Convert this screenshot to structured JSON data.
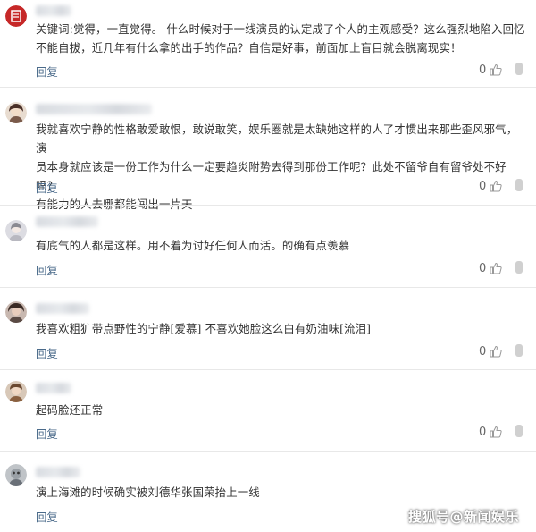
{
  "comments": [
    {
      "text": "关键词:觉得，一直觉得。 什么时候对于一线演员的认定成了个人的主观感受？这么强烈地陷入回忆\n不能自拔，近几年有什么拿的出手的作品？自信是好事，前面加上盲目就会脱离现实！",
      "reply": "回复",
      "likes": "0",
      "avatar_color": "#c62828"
    },
    {
      "text": "我就喜欢宁静的性格敢爱敢恨，敢说敢笑，娱乐圈就是太缺她这样的人了才惯出来那些歪风邪气，演\n员本身就应该是一份工作为什么一定要趋炎附势去得到那份工作呢？此处不留爷自有留爷处不好吗？\n有能力的人去哪都能闯出一片天",
      "reply": "回复",
      "likes": "0",
      "avatar_color": "#7a5a4a"
    },
    {
      "text": "有底气的人都是这样。用不着为讨好任何人而活。的确有点羡慕",
      "reply": "回复",
      "likes": "0",
      "avatar_color": "#b8b8c0"
    },
    {
      "text": "我喜欢粗犷带点野性的宁静[爱慕] 不喜欢她脸这么白有奶油味[流泪]",
      "reply": "回复",
      "likes": "0",
      "avatar_color": "#5a4a44"
    },
    {
      "text": "起码脸还正常",
      "reply": "回复",
      "likes": "0",
      "avatar_color": "#8a6040"
    },
    {
      "text": "演上海滩的时候确实被刘德华张国荣抬上一线",
      "reply": "回复",
      "likes": "0",
      "avatar_color": "#6a7078"
    }
  ],
  "watermark": "搜狐号@新闻娱乐",
  "colors": {
    "text": "#333333",
    "reply": "#4a6a8a",
    "divider": "#e8e8e8"
  },
  "icons": {
    "like": "thumbs-up-icon"
  }
}
